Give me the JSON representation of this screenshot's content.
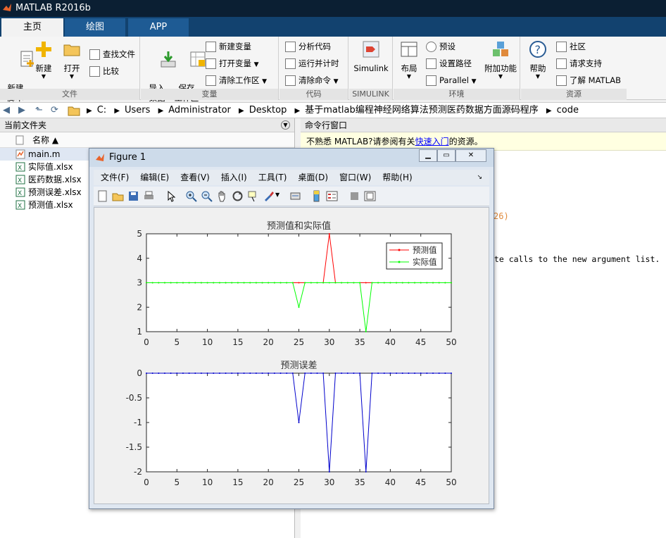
{
  "window": {
    "title": "MATLAB R2016b"
  },
  "tabs": [
    {
      "label": "主页",
      "active": true
    },
    {
      "label": "绘图"
    },
    {
      "label": "APP"
    }
  ],
  "ribbon": {
    "file": {
      "new_script": "新建\n脚本",
      "new": "新建",
      "open": "打开",
      "find_files": "查找文件",
      "compare": "比较",
      "label": "文件"
    },
    "variable": {
      "import": "导入\n数据",
      "save_ws": "保存\n工作区",
      "new_var": "新建变量",
      "open_var": "打开变量",
      "clear_ws": "清除工作区",
      "label": "变量"
    },
    "code": {
      "analyze": "分析代码",
      "run_time": "运行并计时",
      "clear_cmd": "清除命令",
      "label": "代码"
    },
    "simulink": {
      "btn": "Simulink",
      "label": "SIMULINK"
    },
    "env": {
      "layout": "布局",
      "prefs": "预设",
      "set_path": "设置路径",
      "parallel": "Parallel",
      "addons": "附加功能",
      "label": "环境"
    },
    "resources": {
      "help": "帮助",
      "community": "社区",
      "support": "请求支持",
      "learn": "了解 MATLAB",
      "label": "资源"
    }
  },
  "address": {
    "crumbs": [
      "C:",
      "Users",
      "Administrator",
      "Desktop",
      "基于matlab编程神经网络算法预测医药数据方面源码程序",
      "code"
    ]
  },
  "file_panel": {
    "title": "当前文件夹",
    "column": "名称 ▲",
    "files": [
      {
        "name": "main.m",
        "type": "m",
        "selected": true
      },
      {
        "name": "实际值.xlsx",
        "type": "xlsx"
      },
      {
        "name": "医药数据.xlsx",
        "type": "xlsx"
      },
      {
        "name": "预测误差.xlsx",
        "type": "xlsx"
      },
      {
        "name": "预测值.xlsx",
        "type": "xlsx"
      }
    ]
  },
  "command_window": {
    "title": "命令行窗口",
    "note_prefix": "不熟悉 MATLAB?请参阅有关",
    "note_link": "快速入门",
    "note_suffix": "的资源。",
    "partial_1": "26)",
    "partial_2": "ate calls to the new argument list."
  },
  "figure": {
    "title": "Figure 1",
    "menu": [
      "文件(F)",
      "编辑(E)",
      "查看(V)",
      "插入(I)",
      "工具(T)",
      "桌面(D)",
      "窗口(W)",
      "帮助(H)"
    ]
  },
  "chart_data": [
    {
      "type": "line",
      "title": "预测值和实际值",
      "xlim": [
        0,
        50
      ],
      "ylim": [
        1,
        5
      ],
      "xticks": [
        "0",
        "5",
        "10",
        "15",
        "20",
        "25",
        "30",
        "35",
        "40",
        "45",
        "50"
      ],
      "yticks": [
        "1",
        "2",
        "3",
        "4",
        "5"
      ],
      "legend": "top-right",
      "series": [
        {
          "name": "预测值",
          "color": "#ff0000",
          "x": [
            0,
            1,
            2,
            3,
            4,
            5,
            6,
            7,
            8,
            9,
            10,
            11,
            12,
            13,
            14,
            15,
            16,
            17,
            18,
            19,
            20,
            21,
            22,
            23,
            24,
            25,
            26,
            27,
            28,
            29,
            30,
            31,
            32,
            33,
            34,
            35,
            36,
            37,
            38,
            39,
            40,
            41,
            42,
            43,
            44,
            45,
            46,
            47,
            48,
            49,
            50
          ],
          "y": [
            3,
            3,
            3,
            3,
            3,
            3,
            3,
            3,
            3,
            3,
            3,
            3,
            3,
            3,
            3,
            3,
            3,
            3,
            3,
            3,
            3,
            3,
            3,
            3,
            3,
            3,
            3,
            3,
            3,
            3,
            5,
            3,
            3,
            3,
            3,
            3,
            3,
            3,
            3,
            3,
            3,
            3,
            3,
            3,
            3,
            3,
            3,
            3,
            3,
            3,
            3
          ]
        },
        {
          "name": "实际值",
          "color": "#00ff00",
          "x": [
            0,
            1,
            2,
            3,
            4,
            5,
            6,
            7,
            8,
            9,
            10,
            11,
            12,
            13,
            14,
            15,
            16,
            17,
            18,
            19,
            20,
            21,
            22,
            23,
            24,
            25,
            26,
            27,
            28,
            29,
            30,
            31,
            32,
            33,
            34,
            35,
            36,
            37,
            38,
            39,
            40,
            41,
            42,
            43,
            44,
            45,
            46,
            47,
            48,
            49,
            50
          ],
          "y": [
            3,
            3,
            3,
            3,
            3,
            3,
            3,
            3,
            3,
            3,
            3,
            3,
            3,
            3,
            3,
            3,
            3,
            3,
            3,
            3,
            3,
            3,
            3,
            3,
            3,
            2,
            3,
            3,
            3,
            3,
            3,
            3,
            3,
            3,
            3,
            3,
            1,
            3,
            3,
            3,
            3,
            3,
            3,
            3,
            3,
            3,
            3,
            3,
            3,
            3,
            3
          ]
        }
      ]
    },
    {
      "type": "line",
      "title": "预测误差",
      "xlim": [
        0,
        50
      ],
      "ylim": [
        -2,
        0
      ],
      "xticks": [
        "0",
        "5",
        "10",
        "15",
        "20",
        "25",
        "30",
        "35",
        "40",
        "45",
        "50"
      ],
      "yticks": [
        "-2",
        "-1.5",
        "-1",
        "-0.5",
        "0"
      ],
      "series": [
        {
          "color": "#0000cc",
          "x": [
            0,
            1,
            2,
            3,
            4,
            5,
            6,
            7,
            8,
            9,
            10,
            11,
            12,
            13,
            14,
            15,
            16,
            17,
            18,
            19,
            20,
            21,
            22,
            23,
            24,
            25,
            26,
            27,
            28,
            29,
            30,
            31,
            32,
            33,
            34,
            35,
            36,
            37,
            38,
            39,
            40,
            41,
            42,
            43,
            44,
            45,
            46,
            47,
            48,
            49,
            50
          ],
          "y": [
            0,
            0,
            0,
            0,
            0,
            0,
            0,
            0,
            0,
            0,
            0,
            0,
            0,
            0,
            0,
            0,
            0,
            0,
            0,
            0,
            0,
            0,
            0,
            0,
            0,
            -1,
            0,
            0,
            0,
            0,
            -2,
            0,
            0,
            0,
            0,
            0,
            -2,
            0,
            0,
            0,
            0,
            0,
            0,
            0,
            0,
            0,
            0,
            0,
            0,
            0,
            0
          ]
        }
      ]
    }
  ]
}
